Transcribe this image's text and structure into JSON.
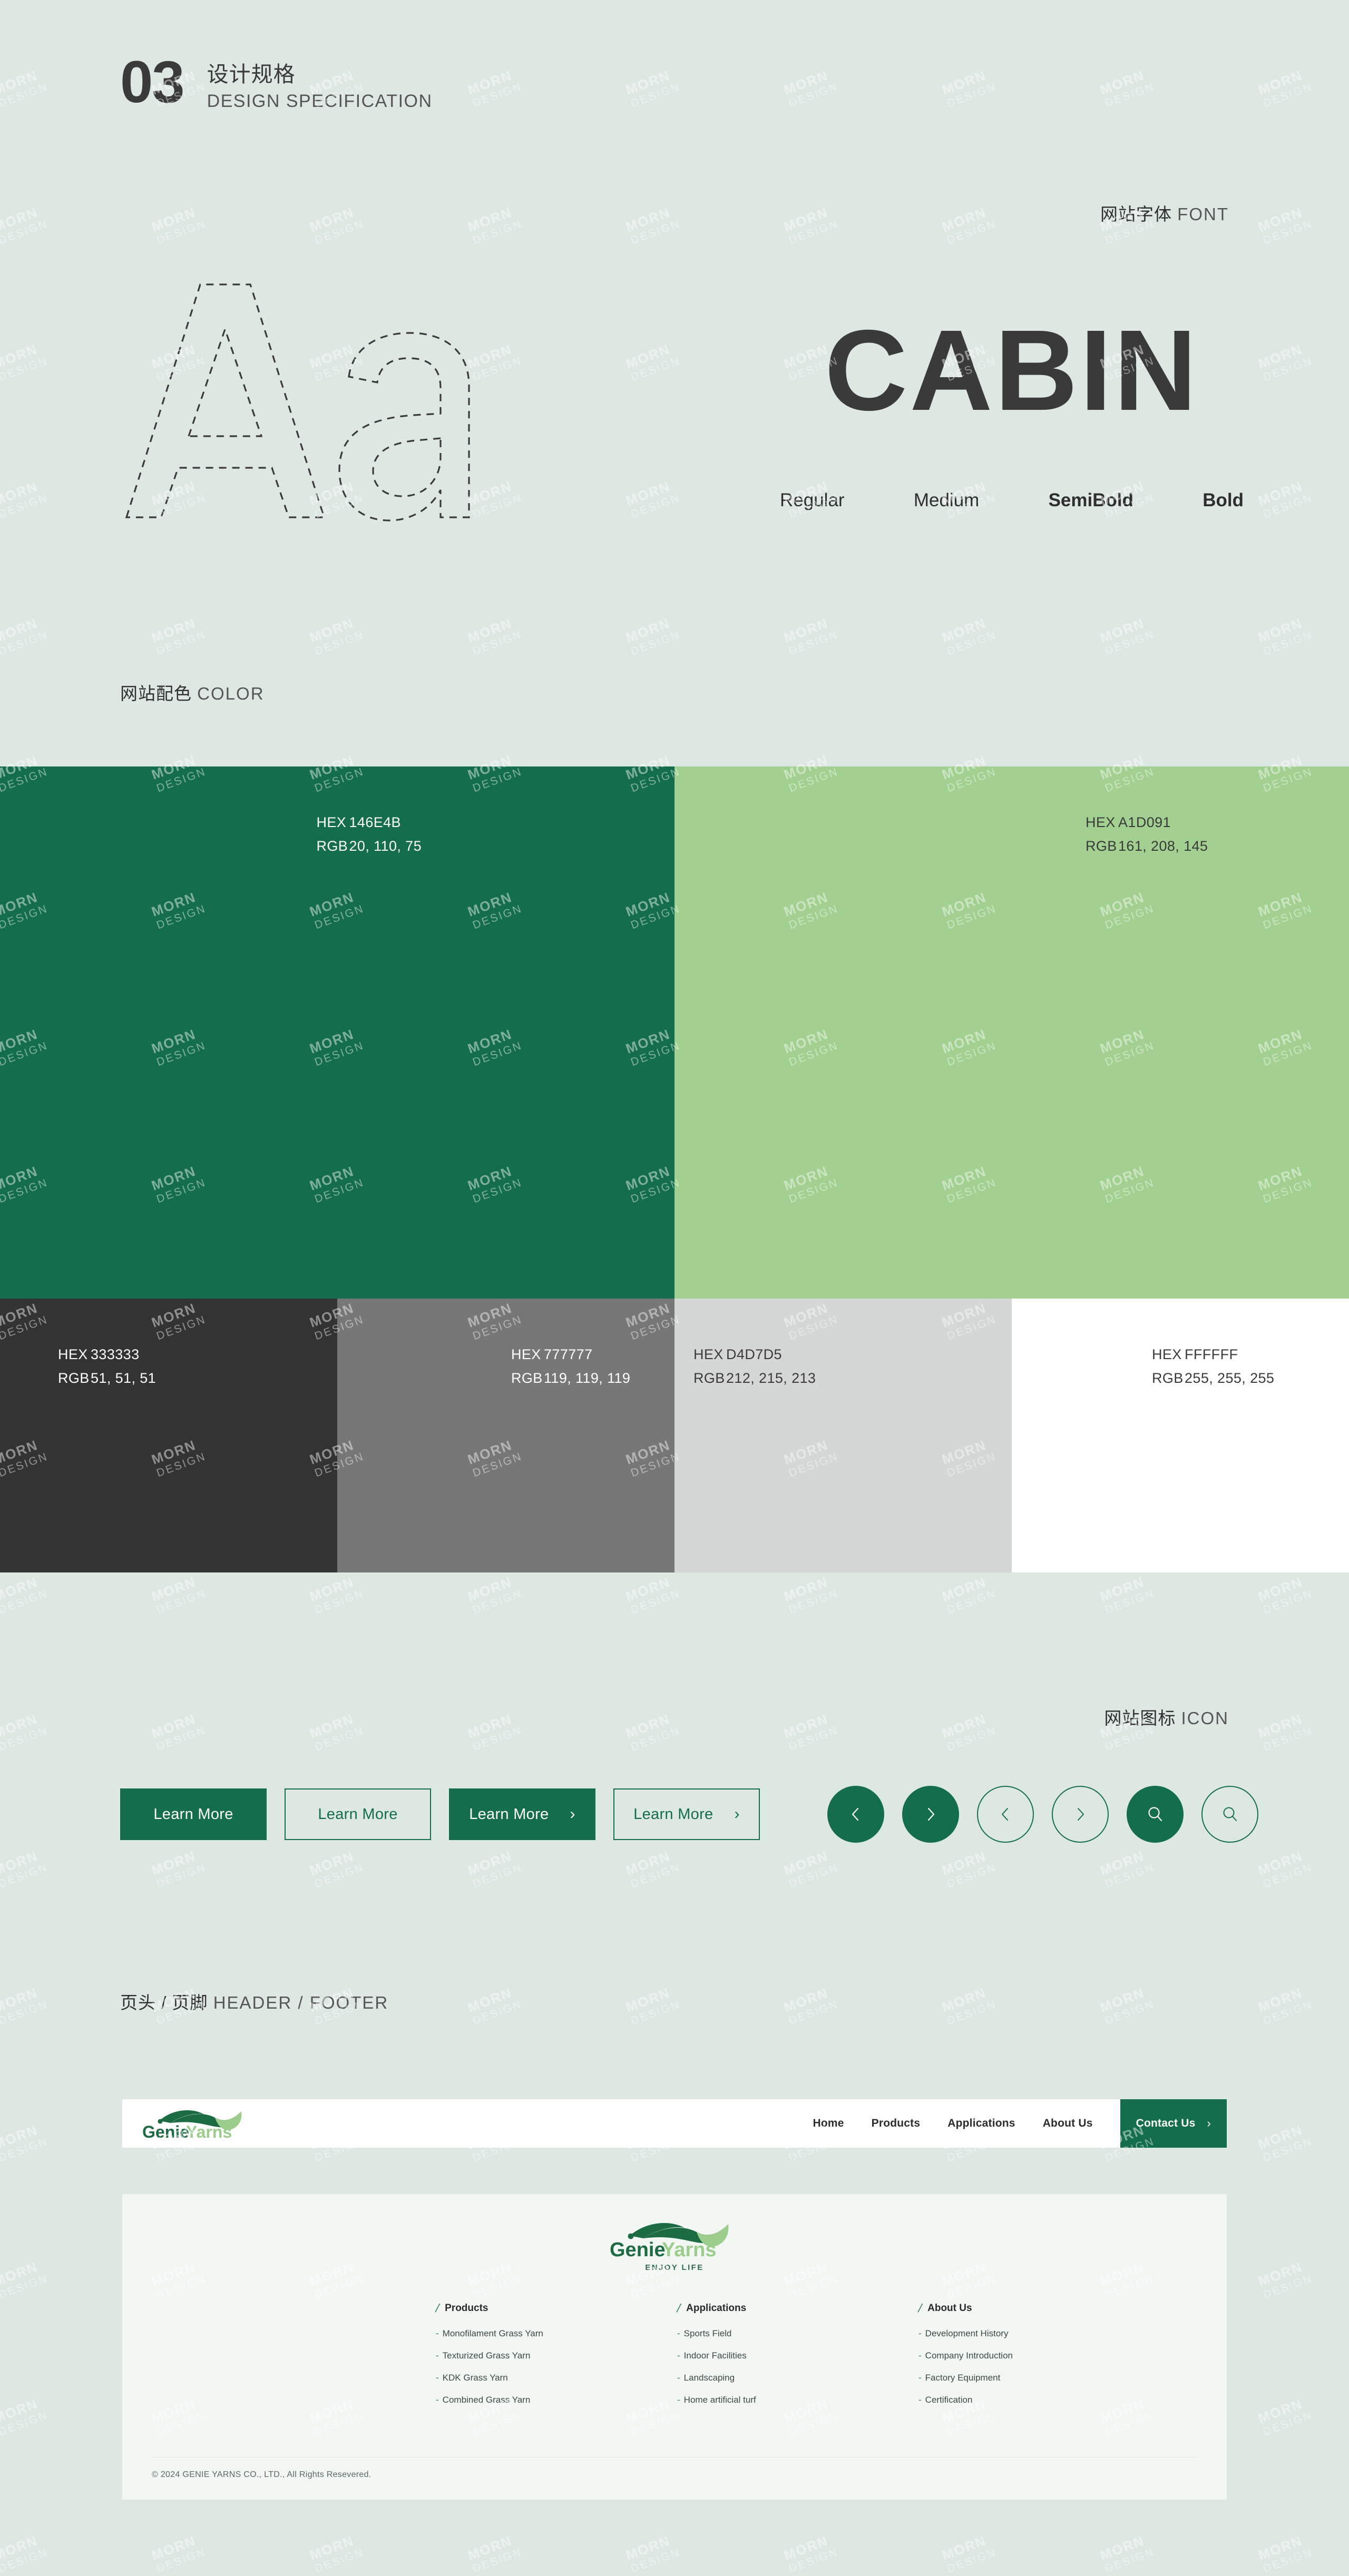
{
  "doc": {
    "number": "03",
    "title_cn": "设计规格",
    "title_en": "DESIGN SPECIFICATION"
  },
  "font_section": {
    "label_cn": "网站字体",
    "label_en": "FONT",
    "specimen_glyphs": "Aa",
    "family_name": "CABIN",
    "weights": [
      "Regular",
      "Medium",
      "SemiBold",
      "Bold"
    ]
  },
  "color_section": {
    "label_cn": "网站配色",
    "label_en": "COLOR",
    "hex_key": "HEX",
    "rgb_key": "RGB",
    "primary_row": [
      {
        "name": "primary-green",
        "hex": "146E4B",
        "css": "#146E4B",
        "rgb": "20, 110, 75",
        "text": "#ffffff",
        "flex": 50
      },
      {
        "name": "light-green",
        "hex": "A1D091",
        "css": "#A1D091",
        "rgb": "161, 208, 145",
        "text": "#3a3a3a",
        "flex": 50
      }
    ],
    "neutral_row": [
      {
        "name": "dark-gray",
        "hex": "333333",
        "css": "#333333",
        "rgb": "51, 51, 51",
        "text": "#ffffff",
        "flex": 25
      },
      {
        "name": "mid-gray",
        "hex": "777777",
        "css": "#777777",
        "rgb": "119, 119, 119",
        "text": "#ffffff",
        "flex": 25
      },
      {
        "name": "light-gray",
        "hex": "D4D7D5",
        "css": "#D4D7D5",
        "rgb": "212, 215, 213",
        "text": "#3a3a3a",
        "flex": 25
      },
      {
        "name": "white",
        "hex": "FFFFFF",
        "css": "#FFFFFF",
        "rgb": "255, 255, 255",
        "text": "#3a3a3a",
        "flex": 25
      }
    ]
  },
  "icon_section": {
    "label_cn": "网站图标",
    "label_en": "ICON",
    "buttons": [
      {
        "label": "Learn More",
        "style": "fill",
        "arrow": false
      },
      {
        "label": "Learn More",
        "style": "out",
        "arrow": false
      },
      {
        "label": "Learn More",
        "style": "fill",
        "arrow": true,
        "arrow_glyph": "›"
      },
      {
        "label": "Learn More",
        "style": "out",
        "arrow": true,
        "arrow_glyph": "›"
      }
    ],
    "circles": [
      {
        "icon": "chevron-left-icon",
        "style": "fill"
      },
      {
        "icon": "chevron-right-icon",
        "style": "fill"
      },
      {
        "icon": "chevron-left-icon",
        "style": "out"
      },
      {
        "icon": "chevron-right-icon",
        "style": "out"
      },
      {
        "icon": "search-icon",
        "style": "fill"
      },
      {
        "icon": "search-icon",
        "style": "out"
      }
    ]
  },
  "header_footer_section": {
    "label_cn": "页头 / 页脚",
    "label_en": "HEADER / FOOTER",
    "header": {
      "brand_part1": "Genie",
      "brand_part2": "Yarns",
      "nav": [
        "Home",
        "Products",
        "Applications",
        "About Us"
      ],
      "cta_label": "Contact Us",
      "cta_arrow": "›"
    },
    "footer": {
      "brand_part1": "Genie",
      "brand_part2": "Yarns",
      "tagline": "ENJOY LIFE",
      "columns": [
        {
          "title": "Products",
          "items": [
            "Monofilament Grass Yarn",
            "Texturized Grass Yarn",
            "KDK Grass Yarn",
            "Combined Grass Yarn"
          ]
        },
        {
          "title": "Applications",
          "items": [
            "Sports Field",
            "Indoor Facilities",
            "Landscaping",
            "Home artificial turf"
          ]
        },
        {
          "title": "About Us",
          "items": [
            "Development History",
            "Company Introduction",
            "Factory Equipment",
            "Certification"
          ]
        }
      ],
      "copyright": "© 2024 GENIE YARNS CO., LTD., All Rights Resevered."
    }
  },
  "watermark": {
    "line1": "MORN",
    "line2": "DESIGN"
  }
}
